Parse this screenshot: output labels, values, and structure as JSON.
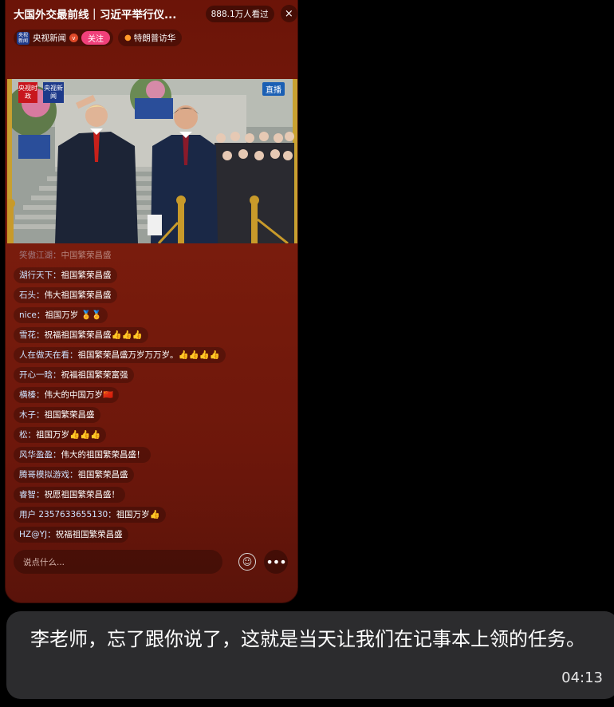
{
  "live_room": {
    "title": "大国外交最前线｜习近平举行仪...",
    "viewers": "888.1万人看过",
    "close_icon": "×",
    "host_name": "央视新闻",
    "host_avatar_text": "央视新闻",
    "verified_badge": "v",
    "follow_label": "关注",
    "topic": "特朗普访华",
    "video": {
      "live_tag": "直播",
      "logo_left": "央视时政",
      "logo_right": "央视新闻"
    },
    "comments": [
      {
        "name": "笑傲江湖：",
        "text": "中国繁荣昌盛",
        "faded": true
      },
      {
        "name": "湖行天下：",
        "text": "祖国繁荣昌盛"
      },
      {
        "name": "石头：",
        "text": "伟大祖国繁荣昌盛"
      },
      {
        "name": "nice：",
        "text": "祖国万岁 🏅🏅"
      },
      {
        "name": "雪花：",
        "text": "祝福祖国繁荣昌盛👍👍👍"
      },
      {
        "name": "人在做天在看：",
        "text": "祖国繁荣昌盛万岁万万岁。👍👍👍👍"
      },
      {
        "name": "开心一晗：",
        "text": "祝福祖国繁荣富强"
      },
      {
        "name": "横榛：",
        "text": "伟大的中国万岁🇨🇳"
      },
      {
        "name": "木子：",
        "text": "祖国繁荣昌盛"
      },
      {
        "name": "松：",
        "text": "祖国万岁👍👍👍"
      },
      {
        "name": "风华盈盈：",
        "text": "伟大的祖国繁荣昌盛！"
      },
      {
        "name": "腾哥模拟游戏：",
        "text": "祖国繁荣昌盛"
      },
      {
        "name": "睿智：",
        "text": "祝愿祖国繁荣昌盛！"
      },
      {
        "name": "用户 2357633655130：",
        "text": "祖国万岁👍"
      },
      {
        "name": "HZ@YJ：",
        "text": "祝福祖国繁荣昌盛"
      }
    ],
    "input_placeholder": "说点什么...",
    "more_icon": "•••"
  },
  "message": {
    "text": "李老师，忘了跟你说了，这就是当天让我们在记事本上领的任务。",
    "time": "04:13"
  }
}
